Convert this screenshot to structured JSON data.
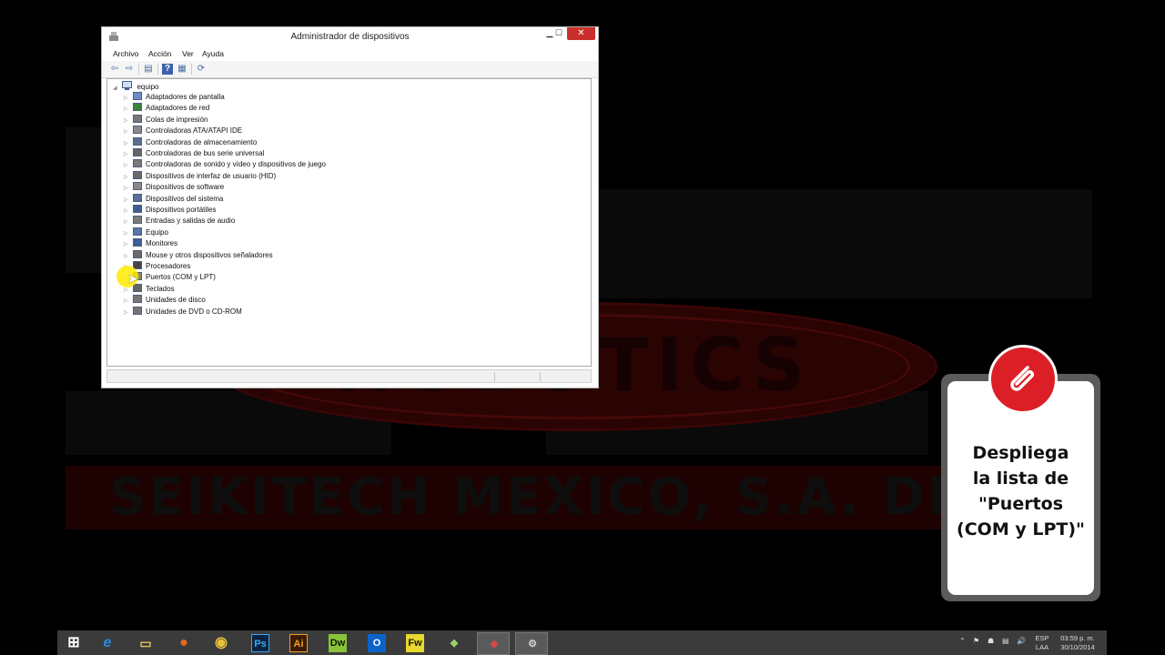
{
  "window": {
    "title": "Administrador de dispositivos",
    "controls": {
      "minimize": "▁",
      "maximize": "☐",
      "close": "✕"
    }
  },
  "menubar": [
    "Archivo",
    "Acción",
    "Ver",
    "Ayuda"
  ],
  "toolbar": {
    "back": "⇦",
    "forward": "⇨",
    "properties": "▤",
    "help": "?",
    "view": "▦",
    "scan": "⟳"
  },
  "tree": {
    "expand_glyph": "◢",
    "collapse_glyph": "▷",
    "root": "equipo",
    "nodes": [
      "Adaptadores de pantalla",
      "Adaptadores de red",
      "Colas de impresión",
      "Controladoras ATA/ATAPI IDE",
      "Controladoras de almacenamiento",
      "Controladoras de bus serie universal",
      "Controladoras de sonido y vídeo y dispositivos de juego",
      "Dispositivos de interfaz de usuario (HID)",
      "Dispositivos de software",
      "Dispositivos del sistema",
      "Dispositivos portátiles",
      "Entradas y salidas de audio",
      "Equipo",
      "Monitores",
      "Mouse y otros dispositivos señaladores",
      "Procesadores",
      "Puertos (COM y LPT)",
      "Teclados",
      "Unidades de disco",
      "Unidades de DVD o CD-ROM"
    ]
  },
  "watermark": {
    "brand": "ROBOTICS",
    "company": "SEIKITECH MEXICO, S.A. DE"
  },
  "callout": {
    "lines": [
      "Despliega",
      "la lista de",
      "\"Puertos",
      "(COM y LPT)\""
    ],
    "accent_color": "#dc1f26",
    "icon": "paperclip-icon"
  },
  "taskbar": {
    "apps": [
      {
        "name": "start-button",
        "glyph": "⊞"
      },
      {
        "name": "internet-explorer",
        "glyph": "e"
      },
      {
        "name": "file-explorer",
        "glyph": "▭"
      },
      {
        "name": "firefox",
        "glyph": "●"
      },
      {
        "name": "chrome",
        "glyph": "◉"
      },
      {
        "name": "photoshop",
        "glyph": "Ps"
      },
      {
        "name": "illustrator",
        "glyph": "Ai"
      },
      {
        "name": "dreamweaver",
        "glyph": "Dw"
      },
      {
        "name": "outlook",
        "glyph": "O"
      },
      {
        "name": "fireworks",
        "glyph": "Fw"
      },
      {
        "name": "app-tool",
        "glyph": "◆"
      },
      {
        "name": "app-remote",
        "glyph": "◈"
      },
      {
        "name": "device-manager",
        "glyph": "⚙"
      }
    ],
    "tray_icons": [
      "⌃",
      "⚑",
      "☗",
      "▤",
      "🔊"
    ],
    "language": {
      "lang": "ESP",
      "region": "LAA"
    },
    "clock": {
      "time": "03:59 p. m.",
      "date": "30/10/2014"
    }
  }
}
